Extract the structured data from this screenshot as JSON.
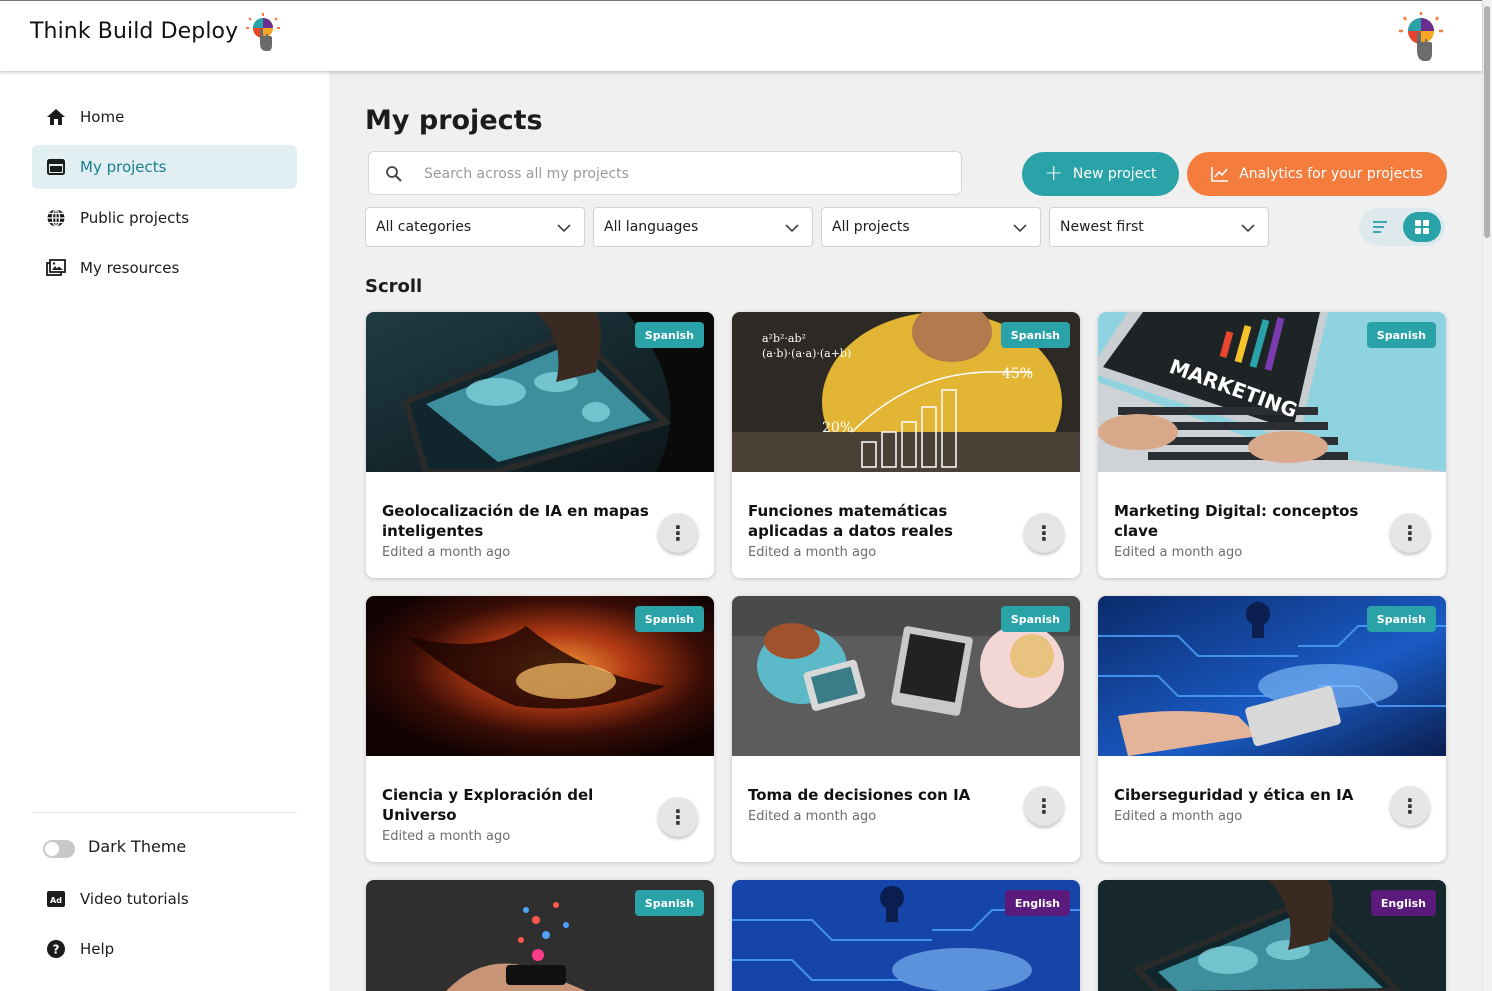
{
  "app": {
    "title": "Think Build Deploy"
  },
  "sidebar": {
    "items": [
      {
        "label": "Home",
        "icon": "home-icon",
        "active": false
      },
      {
        "label": "My projects",
        "icon": "projects-icon",
        "active": true
      },
      {
        "label": "Public projects",
        "icon": "globe-icon",
        "active": false
      },
      {
        "label": "My resources",
        "icon": "image-gallery-icon",
        "active": false
      }
    ],
    "dark_theme_label": "Dark Theme",
    "dark_theme_on": false,
    "video_tutorials_label": "Video tutorials",
    "help_label": "Help"
  },
  "main": {
    "page_title": "My projects",
    "search_placeholder": "Search across all my projects",
    "new_project_label": "New project",
    "analytics_label": "Analytics for your projects",
    "filters": {
      "category": "All categories",
      "language": "All languages",
      "projects": "All projects",
      "sort": "Newest first"
    },
    "view_mode": "grid",
    "section_title": "Scroll"
  },
  "projects": [
    {
      "title": "Geolocalización de IA en mapas inteligentes",
      "edited": "Edited a month ago",
      "language": "Spanish"
    },
    {
      "title": "Funciones matemáticas aplicadas a datos reales",
      "edited": "Edited a month ago",
      "language": "Spanish"
    },
    {
      "title": "Marketing Digital: conceptos clave",
      "edited": "Edited a month ago",
      "language": "Spanish"
    },
    {
      "title": "Ciencia y Exploración del Universo",
      "edited": "Edited a month ago",
      "language": "Spanish"
    },
    {
      "title": "Toma de decisiones con IA",
      "edited": "Edited a month ago",
      "language": "Spanish"
    },
    {
      "title": "Ciberseguridad y ética en IA",
      "edited": "Edited a month ago",
      "language": "Spanish"
    },
    {
      "title": "",
      "edited": "",
      "language": "Spanish"
    },
    {
      "title": "",
      "edited": "",
      "language": "English"
    },
    {
      "title": "",
      "edited": "",
      "language": "English"
    }
  ],
  "colors": {
    "accent_teal": "#2aa3a8",
    "accent_orange": "#f47c3c",
    "english_badge": "#5b1b7c"
  }
}
